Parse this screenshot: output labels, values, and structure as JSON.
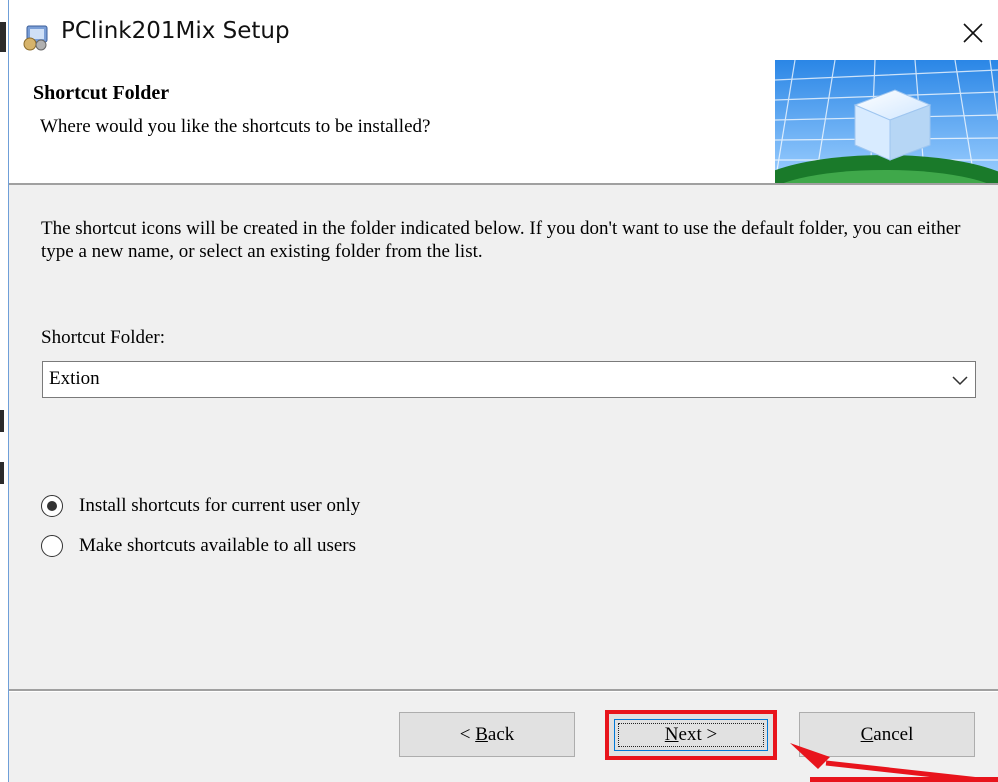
{
  "window": {
    "title": "PClink201Mix Setup",
    "close_symbol": "×"
  },
  "header": {
    "title": "Shortcut Folder",
    "subtitle": "Where would you like the shortcuts to be installed?"
  },
  "body": {
    "description": "The shortcut icons will be created in the folder indicated below. If you don't want to use the default folder, you can either type a new name, or select an existing folder from the list.",
    "folder_label": "Shortcut Folder:",
    "folder_value": "Extion",
    "radio_options": [
      {
        "label": "Install shortcuts for current user only",
        "selected": true
      },
      {
        "label": "Make shortcuts available to all users",
        "selected": false
      }
    ]
  },
  "buttons": {
    "back": {
      "prefix": "< ",
      "mnemonic": "B",
      "rest": "ack"
    },
    "next": {
      "mnemonic": "N",
      "rest": "ext >"
    },
    "cancel": {
      "mnemonic": "C",
      "rest": "ancel"
    }
  },
  "annotation": {
    "highlight_color": "#e8141c",
    "highlighted_control": "Next >"
  }
}
